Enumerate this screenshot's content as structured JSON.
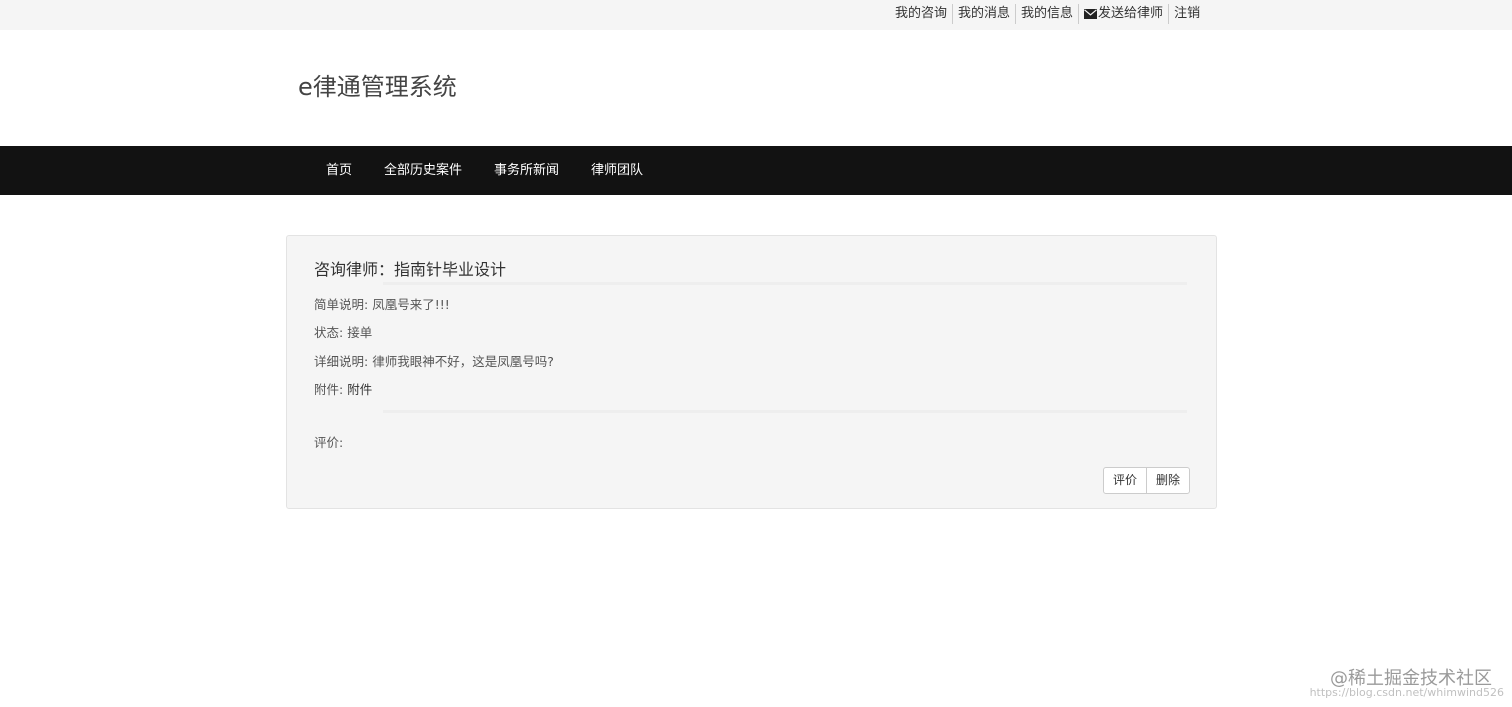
{
  "topbar": {
    "links": [
      {
        "label": "我的咨询"
      },
      {
        "label": "我的消息"
      },
      {
        "label": "我的信息"
      },
      {
        "label": "发送给律师",
        "icon": "envelope-icon"
      },
      {
        "label": "注销"
      }
    ]
  },
  "header": {
    "title": "e律通管理系统"
  },
  "nav": {
    "items": [
      {
        "label": "首页"
      },
      {
        "label": "全部历史案件"
      },
      {
        "label": "事务所新闻"
      },
      {
        "label": "律师团队"
      }
    ]
  },
  "consult": {
    "title": "咨询律师：指南针毕业设计",
    "summary_label": "简单说明:",
    "summary_value": "凤凰号来了!!!",
    "status_label": "状态:",
    "status_value": "接单",
    "detail_label": "详细说明:",
    "detail_value": "律师我眼神不好，这是凤凰号吗?",
    "attachment_label": "附件:",
    "attachment_value": "附件",
    "rating_label": "评价:",
    "rate_button": "评价",
    "delete_button": "删除"
  },
  "watermark": {
    "text": "@稀土掘金技术社区",
    "url": "https://blog.csdn.net/whimwind526"
  },
  "colors": {
    "navbar_bg": "#121212",
    "topbar_bg": "#f5f5f5",
    "panel_bg": "#f5f5f5"
  }
}
